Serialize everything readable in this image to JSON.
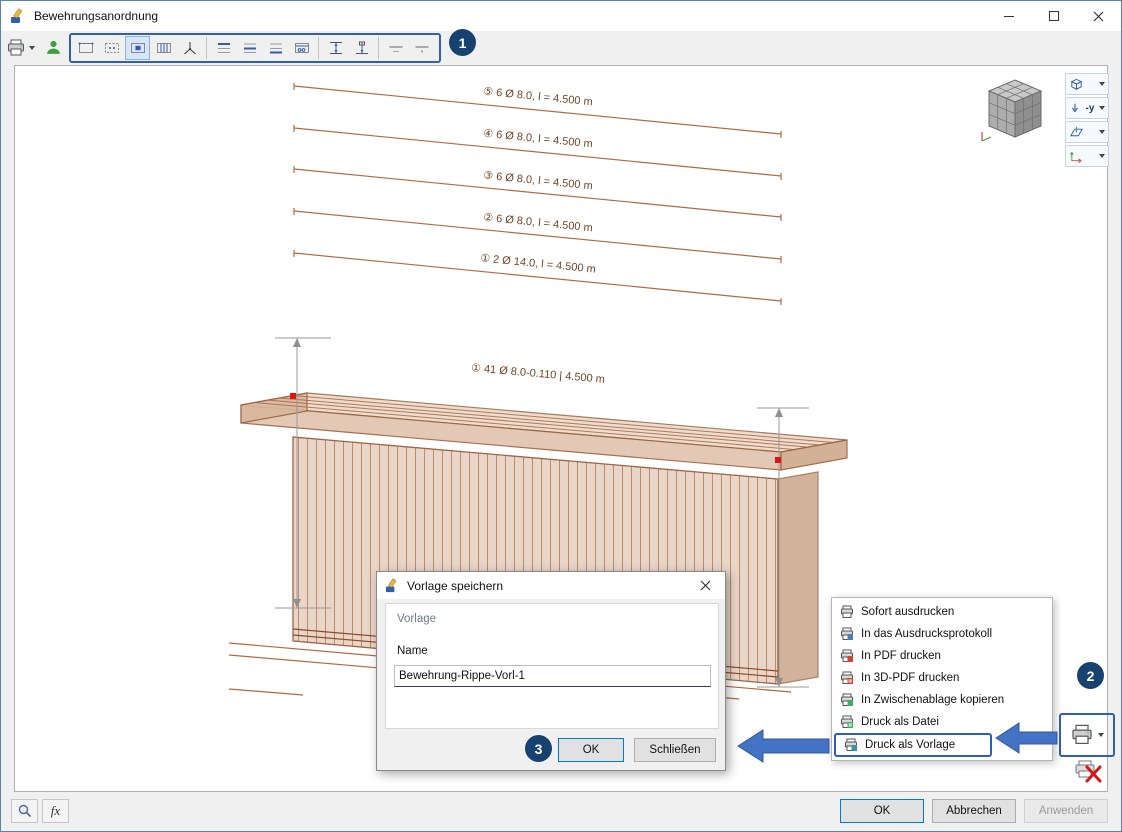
{
  "window": {
    "title": "Bewehrungsanordnung"
  },
  "canvas": {
    "rebar_labels": [
      "⑤ 6 Ø 8.0, l = 4.500 m",
      "④ 6 Ø 8.0, l = 4.500 m",
      "③ 6 Ø 8.0, l = 4.500 m",
      "② 6 Ø 8.0, l = 4.500 m",
      "① 2 Ø 14.0, l = 4.500 m"
    ],
    "beam_label": "① 41 Ø 8.0-0.110 | 4.500 m",
    "view_direction_label": "-y"
  },
  "dialog": {
    "title": "Vorlage speichern",
    "section_label": "Vorlage",
    "name_label": "Name",
    "name_value": "Bewehrung-Rippe-Vorl-1",
    "ok_label": "OK",
    "close_label": "Schließen"
  },
  "print_menu": {
    "items": [
      "Sofort ausdrucken",
      "In das Ausdrucksprotokoll",
      "In PDF drucken",
      "In 3D-PDF drucken",
      "In Zwischenablage kopieren",
      "Druck als Datei",
      "Druck als Vorlage"
    ]
  },
  "footer": {
    "ok_label": "OK",
    "cancel_label": "Abbrechen",
    "apply_label": "Anwenden",
    "fx_label": "fx"
  },
  "callouts": [
    "1",
    "2",
    "3"
  ],
  "colors": {
    "accent_blue": "#2f5fae",
    "callout_blue": "#17416e",
    "rebar_brown": "#b06a42",
    "selection_red": "#e01212",
    "default_button_border": "#0078d7"
  }
}
